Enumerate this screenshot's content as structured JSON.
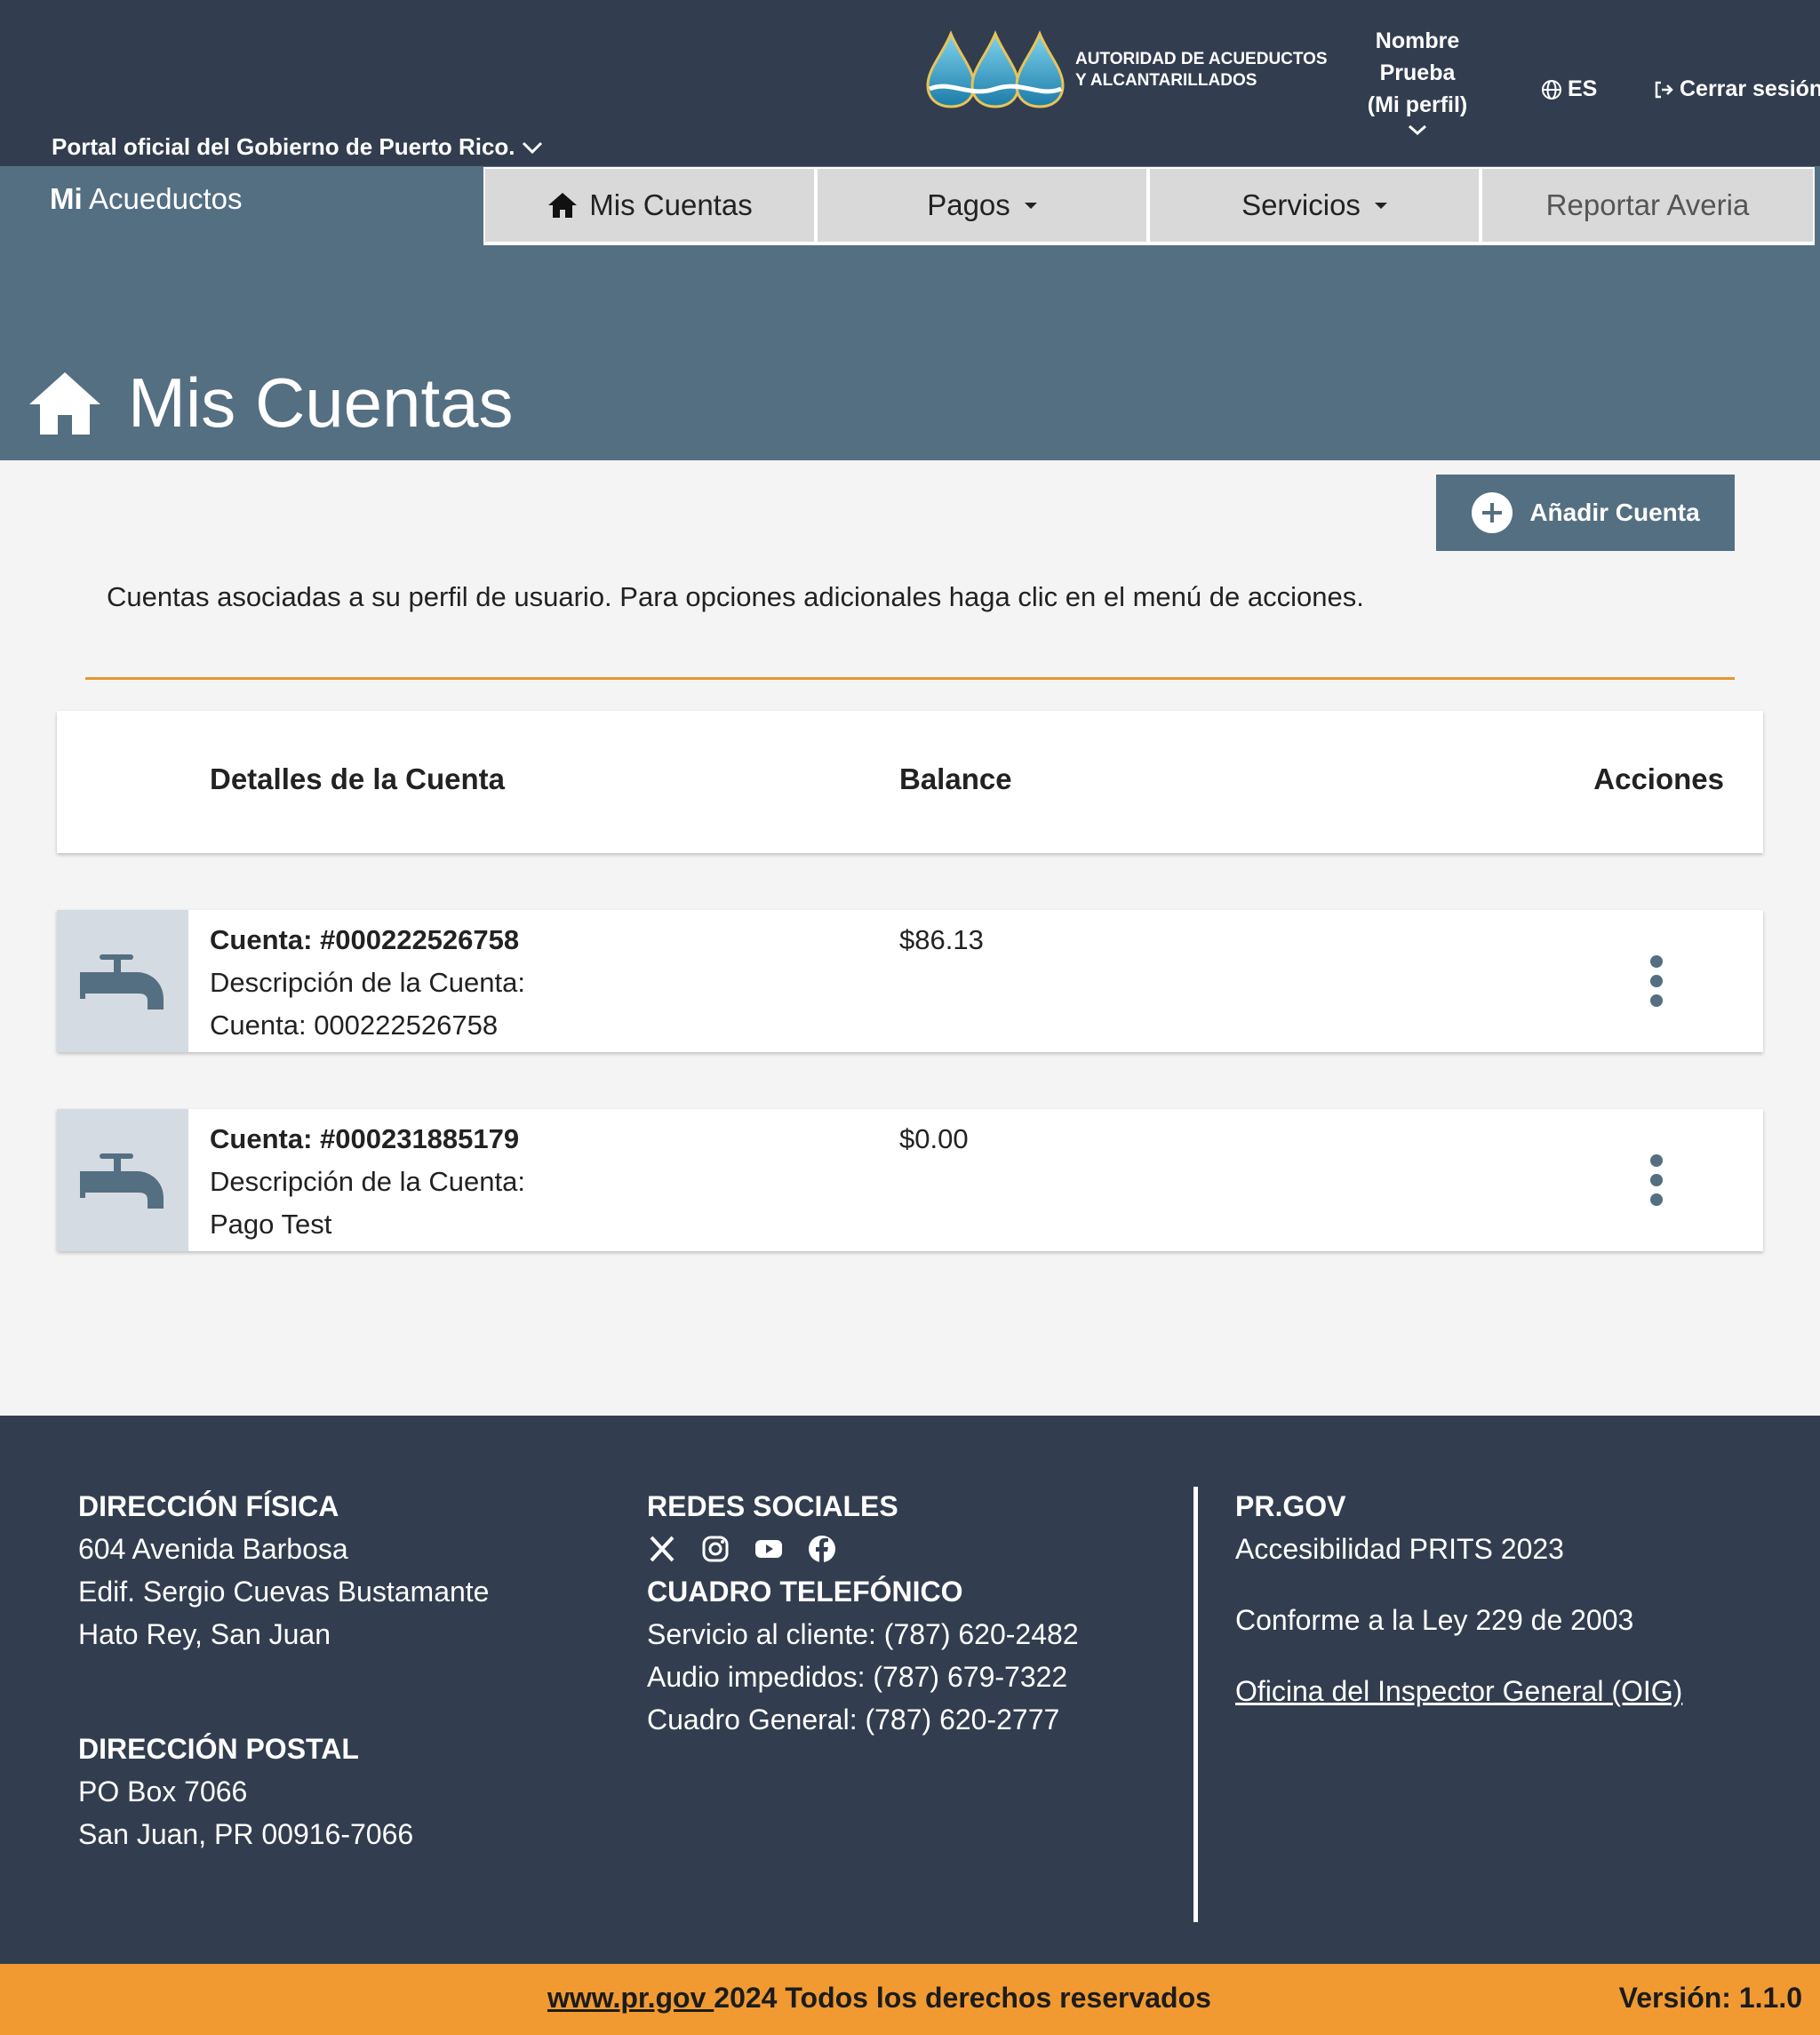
{
  "header": {
    "gov_link": "Portal oficial del Gobierno de Puerto Rico.",
    "logo_line1": "AUTORIDAD DE ACUEDUCTOS",
    "logo_line2": "Y ALCANTARILLADOS",
    "profile_line1": "Nombre",
    "profile_line2": "Prueba",
    "profile_line3": "(Mi perfil)",
    "language": "ES",
    "logout": "Cerrar sesión"
  },
  "brand": {
    "prefix": "Mi",
    "name": "Acueductos"
  },
  "nav": {
    "items": [
      {
        "label": "Mis Cuentas",
        "icon": "home-icon"
      },
      {
        "label": "Pagos",
        "icon": "caret-down-icon"
      },
      {
        "label": "Servicios",
        "icon": "caret-down-icon"
      },
      {
        "label": "Reportar Averia"
      }
    ]
  },
  "page": {
    "title": "Mis Cuentas",
    "add_button": "Añadir Cuenta",
    "intro": "Cuentas asociadas a su perfil de usuario. Para opciones adicionales haga clic en el menú de acciones."
  },
  "table": {
    "headers": [
      "Detalles de la Cuenta",
      "Balance",
      "Acciones"
    ],
    "rows": [
      {
        "account": "Cuenta: #000222526758",
        "desc_label": "Descripción de la Cuenta:",
        "desc_value": "Cuenta: 000222526758",
        "balance": "$86.13"
      },
      {
        "account": "Cuenta: #000231885179",
        "desc_label": "Descripción de la Cuenta:",
        "desc_value": "Pago Test",
        "balance": "$0.00"
      }
    ]
  },
  "footer": {
    "physical": {
      "title": "DIRECCIÓN FÍSICA",
      "lines": [
        "604 Avenida Barbosa",
        "Edif. Sergio Cuevas Bustamante",
        "Hato Rey, San Juan"
      ]
    },
    "postal": {
      "title": "DIRECCIÓN POSTAL",
      "lines": [
        "PO Box 7066",
        "San Juan, PR 00916-7066"
      ]
    },
    "social": {
      "title": "REDES SOCIALES",
      "icons": [
        "x-icon",
        "instagram-icon",
        "youtube-icon",
        "facebook-icon"
      ]
    },
    "phones": {
      "title": "CUADRO TELEFÓNICO",
      "lines": [
        "Servicio al cliente: (787) 620-2482",
        "Audio impedidos: (787) 679-7322",
        "Cuadro General: (787) 620-2777"
      ]
    },
    "prgov": {
      "title": "PR.GOV",
      "accessibility": "Accesibilidad PRITS 2023",
      "law": "Conforme a la Ley 229 de 2003",
      "oig": "Oficina del Inspector General (OIG)"
    }
  },
  "bottom": {
    "link": "www.pr.gov ",
    "rights": "2024 Todos los derechos reservados",
    "version": "Versión: 1.1.0"
  },
  "colors": {
    "header_bg": "#323e4f",
    "band_bg": "#546f82",
    "accent_orange": "#f19a32",
    "nav_bg": "#d9d9d9"
  }
}
